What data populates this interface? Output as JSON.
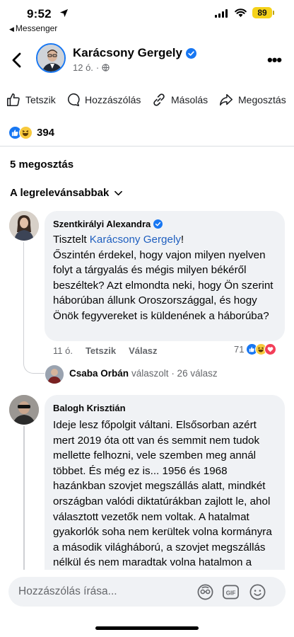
{
  "status_bar": {
    "time": "9:52",
    "back_app": "Messenger",
    "battery": "89",
    "battery_color": "#f5d21a"
  },
  "header": {
    "author": "Karácsony Gergely",
    "time": "12 ó.",
    "verified": true
  },
  "actions": {
    "like": "Tetszik",
    "comment": "Hozzászólás",
    "copy": "Másolás",
    "share": "Megosztás"
  },
  "reactions": {
    "count": "394",
    "types": [
      "like",
      "haha"
    ]
  },
  "shares_label": "5 megosztás",
  "sort_label": "A legrelevánsabbak",
  "comments": [
    {
      "author": "Szentkirályi Alexandra",
      "verified": true,
      "greeting": "Tisztelt ",
      "mention": "Karácsony Gergely",
      "after_mention": "!",
      "body": "Őszintén érdekel, hogy vajon milyen nyelven folyt a tárgyalás és mégis milyen békéről beszéltek? Azt elmondta neki, hogy Ön szerint háborúban állunk Oroszországgal, és hogy Önök fegyvereket is küldenének a háborúba?",
      "time": "11 ó.",
      "like_label": "Tetszik",
      "reply_label": "Válasz",
      "reaction_count": "71",
      "reaction_types": [
        "like",
        "haha",
        "love"
      ],
      "reply_preview": {
        "name": "Csaba Orbán",
        "action": "válaszolt",
        "count": " · 26 válasz"
      }
    },
    {
      "author": "Balogh Krisztián",
      "body": "Ideje lesz főpolgit váltani. Elsősorban azért mert 2019 óta ott van és semmit nem tudok mellette felhozni, vele szemben meg annál többet. És még ez is... 1956 és 1968 hazánkban szovjet megszállás alatt, mindkét országban valódi diktatúrákban zajlott le, ahol választott vezetők nem voltak. A hatalmat gyakorlók soha nem kerültek volna kormányra a második világháború, a szovjet megszállás nélkül és nem maradtak volna hatalmon a"
    }
  ],
  "composer": {
    "placeholder": "Hozzászólás írása..."
  },
  "colors": {
    "accent": "#1877f2",
    "bubble": "#f0f2f5",
    "secondary_text": "#65676b",
    "mention": "#1f5fbf"
  }
}
